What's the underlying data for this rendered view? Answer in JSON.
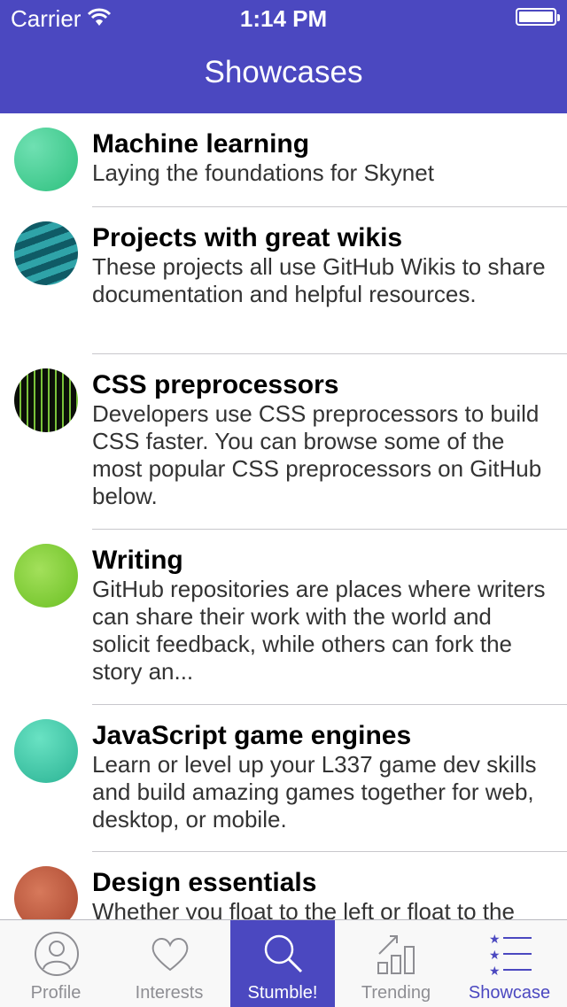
{
  "status_bar": {
    "carrier": "Carrier",
    "time": "1:14 PM"
  },
  "nav": {
    "title": "Showcases"
  },
  "showcases": [
    {
      "name": "Machine learning",
      "description": "Laying the foundations for Skynet",
      "icon": "hex-green-avatar"
    },
    {
      "name": "Projects with great wikis",
      "description": "These projects all use GitHub Wikis to share documentation and helpful resources.",
      "icon": "wave-teal-avatar"
    },
    {
      "name": "CSS preprocessors",
      "description": "Developers use CSS preprocessors to build CSS faster. You can browse some of the most popular CSS preprocessors on GitHub below.",
      "icon": "plaid-green-avatar"
    },
    {
      "name": "Writing",
      "description": "GitHub repositories are places where writers can share their work with the world and solicit feedback, while others can fork the story an...",
      "icon": "dots-lime-avatar"
    },
    {
      "name": "JavaScript game engines",
      "description": "Learn or level up your L337 game dev skills and build amazing games together for web, desktop, or mobile.",
      "icon": "hex-mint-avatar"
    },
    {
      "name": "Design essentials",
      "description": "Whether you float to the left or float to the right, build fast, beautiful, and responsive resources to help you get started.",
      "icon": "hex-rust-avatar"
    }
  ],
  "tabs": [
    {
      "label": "Profile",
      "icon": "person-icon"
    },
    {
      "label": "Interests",
      "icon": "heart-icon"
    },
    {
      "label": "Stumble!",
      "icon": "search-icon"
    },
    {
      "label": "Trending",
      "icon": "bar-chart-icon"
    },
    {
      "label": "Showcase",
      "icon": "star-list-icon"
    }
  ],
  "colors": {
    "accent": "#4b48c0",
    "tab_inactive": "#8e8e93"
  }
}
